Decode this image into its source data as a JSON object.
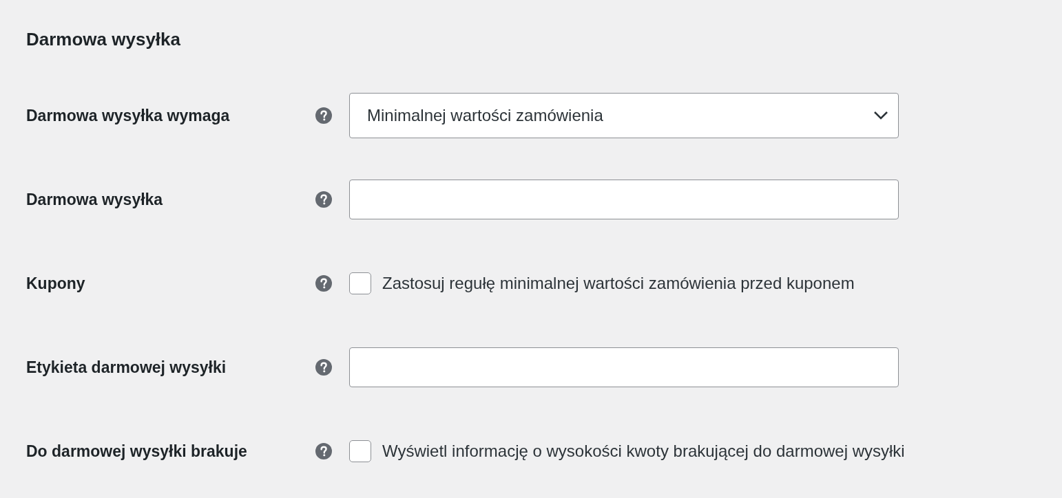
{
  "section": {
    "title": "Darmowa wysyłka"
  },
  "fields": [
    {
      "kind": "select",
      "label": "Darmowa wysyłka wymaga",
      "value": "Minimalnej wartości zamówienia"
    },
    {
      "kind": "text",
      "label": "Darmowa wysyłka"
    },
    {
      "kind": "checkbox",
      "label": "Kupony",
      "option": "Zastosuj regułę minimalnej wartości zamówienia przed kuponem",
      "checked": false
    },
    {
      "kind": "text",
      "label": "Etykieta darmowej wysyłki"
    },
    {
      "kind": "checkbox",
      "label": "Do darmowej wysyłki brakuje",
      "option": "Wyświetl informację o wysokości kwoty brakującej do darmowej wysyłki",
      "checked": false
    }
  ]
}
